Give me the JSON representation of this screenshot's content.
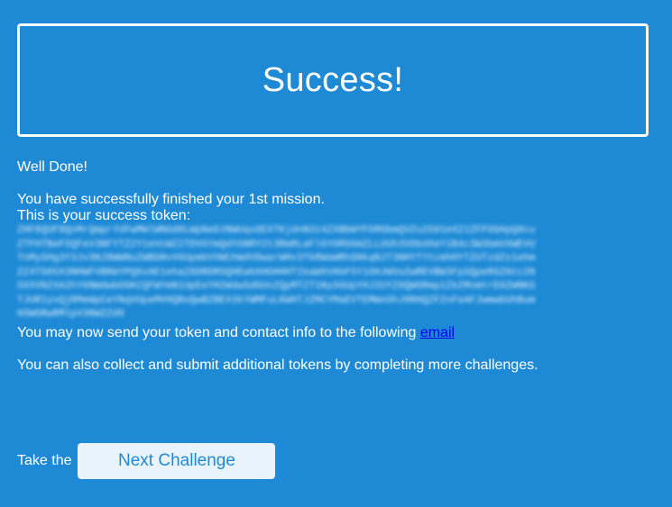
{
  "banner": {
    "title": "Success!"
  },
  "message": {
    "greeting": "Well Done!",
    "finished": "You have successfully finished your 1st mission.",
    "token_intro": "This is your success token:",
    "token": "ZHF8QUF8QnMrQmprYUFwMWlWNGd8LWpNeDJNWUqs8EXTKjdnN314ZXBbWYFDRGbmQVZuZG91eXZ1ZFFDGHpQ8cuZTFHTBeF5QFeV3NFYTZ2Y1eVcWZ2TDVGYmQdYGNRY2t3RmRLaFlGYGRSGmZLLUUh3VDbdXeY1B4c3W3bmVXWEVUTnMySHg3Y3Jv3NJ8WWNuZWBbNvVGUpmbVVWChWdVDwarWHv3TkRWaWRhSNkqNJT3NHYTYtcmhHYTZUTzdZs1ehmZZ4TG05X3NHWFVBRmYPQ0xAE1ehaZ6DRDRSQHEwbXHGHHHTIkaWXVAbF5Y1OHJWVoZwREVBW3FpSQpeRGZNtc2NSXXVNZXA2hY6NWdwbOGKCQFWYmN1UpEeYH2WdwSdGUnZQpMTZT1NySGUpYHJ2UYZ0QWGRmp1ZkZMnmtrE0ZWNKGTJUR1yvQjRMeWpCeYNqVUpeMVHQRoQwBZBEX3kYWMFuLKWHTJZMCYMaEVTEMWxOhJ8RHQZFZnFeAFJwmwbUhBumHSWGRwRMlpV3NWZZd9"
  },
  "send_contact": {
    "text": "You may now send your token and contact info to the following ",
    "link_label": "email"
  },
  "collect_more": "You can also collect and submit additional tokens by completing more challenges.",
  "next": {
    "prefix": "Take the",
    "button_label": "Next Challenge"
  },
  "colors": {
    "background": "#1e8ad6",
    "text": "#ffffff",
    "button_background": "#e9f3fb",
    "button_text": "#1e8ad6",
    "link": "#0000ee"
  }
}
